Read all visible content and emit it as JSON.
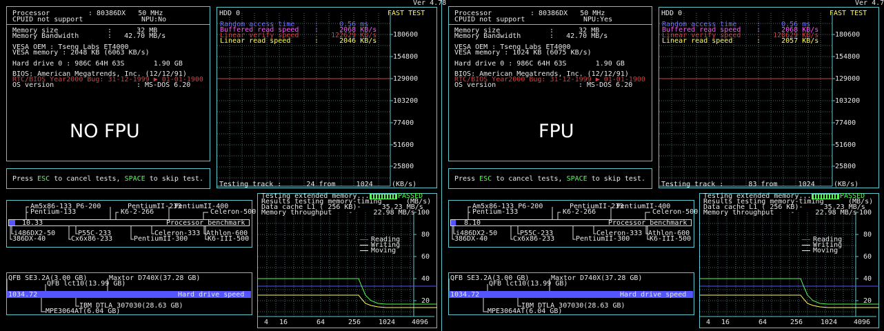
{
  "version": "Ver 4.78",
  "panels": [
    {
      "processor_label": "Processor",
      "processor_value": ": 80386DX   50 MHz",
      "cpuid": "CPUID not support",
      "npu": "NPU:No",
      "mem_size_label": "Memory size",
      "mem_size_value": ":      32 MB",
      "mem_bw_label": "Memory Bandwidth",
      "mem_bw_value": ":   42.70 MB/s",
      "vesa_oem": "VESA OEM : Tseng Labs ET4000",
      "vesa_mem": "VESA memory : 2048 KB (6063 KB/s)",
      "hdd": "Hard drive 0 : 986C 64H 63S       1.90 GB",
      "bios": "BIOS: American Megatrends, Inc. (12/12/91)",
      "y2k": "RTC/BIOS Year2000 Bug: 31-12-1999 ▶ 01-01-1900",
      "os_label": "OS version",
      "os_value": ": MS-DOS 6.20",
      "overlay": "NO FPU",
      "hint_pre": "Press ",
      "hint_esc": "ESC",
      "hint_mid": " to cancel tests, ",
      "hint_space": "SPACE",
      "hint_post": " to skip test.",
      "hdd_title": "HDD 0",
      "fast_test": "FAST TEST",
      "random_label": "Random access time",
      "random_value": ":     0.56 ms",
      "buffered_label": "Buffered read speed",
      "buffered_value": ":     2068 KB/s",
      "verify_label": "Linear verify speed",
      "verify_value": ":   122629 KB/s",
      "linear_label": "Linear read speed",
      "linear_value": ":     2046 KB/s",
      "scale": [
        "180600",
        "154800",
        "129000",
        "103200",
        "77400",
        "51600",
        "25800"
      ],
      "testing_track": "Testing track :      24 from     1024",
      "kbs": "(KB/s)",
      "cpu_top1": "Am5x86-133 P6-200",
      "cpu_top2": "PentiumII-233",
      "cpu_top3": "PentiumII-400",
      "cpu_top4": "Pentium-133",
      "cpu_top5": "K6-2-266",
      "cpu_top6": "Celeron-500",
      "cpu_score": "10.33",
      "cpu_bench_label": "Processor benchmark",
      "cpu_bot1": "i486DX2-50",
      "cpu_bot2": "P55C-233",
      "cpu_bot3": "Celeron-333",
      "cpu_bot4": "Athlon-600",
      "cpu_bot5": "386DX-40",
      "cpu_bot6": "Cx6x86-233",
      "cpu_bot7": "PentiumII-300",
      "cpu_bot8": "K6-III-500",
      "cpu_progress": 0.025,
      "hd_top1": "QFB SE3.2A(3.00 GB)",
      "hd_top2": "Maxtor D740X(37.28 GB)",
      "hd_top3": "QFB lct10(13.99 GB)",
      "hd_score": "1034.72",
      "hd_bench_label": "Hard drive speed",
      "hd_bot1": "IBM DTLA 307030(28.63 GB)",
      "hd_bot2": "MPE3064AT(6.04 GB)",
      "mem_test": "Testing extended memory...",
      "passed": "PASSED",
      "mem_results": "Results testing memory-timing",
      "mbs": "(MB/s)",
      "cache_line": "Data cache L1 ( 256 KB)-     35.23 MB/s",
      "throughput_line": "Memory throughput    -     22.98 MB/s",
      "legend": [
        "Reading",
        "Writing",
        "Moving"
      ],
      "mem_y": [
        "100",
        "80",
        "60",
        "40",
        "20"
      ],
      "mem_x": [
        "4",
        "16",
        "64",
        "256",
        "1024",
        "4096"
      ]
    },
    {
      "processor_label": "Processor",
      "processor_value": ": 80386DX   50 MHz",
      "cpuid": "CPUID not support",
      "npu": "NPU:Yes",
      "mem_size_label": "Memory size",
      "mem_size_value": ":      32 MB",
      "mem_bw_label": "Memory Bandwidth",
      "mem_bw_value": ":   42.70 MB/s",
      "vesa_oem": "VESA OEM : Tseng Labs ET4000",
      "vesa_mem": "VESA memory : 1024 KB (6075 KB/s)",
      "hdd": "Hard drive 0 : 986C 64H 63S       1.90 GB",
      "bios": "BIOS: American Megatrends, Inc. (12/12/91)",
      "y2k": "RTC/BIOS Year2000 Bug: 31-12-1999 ▶ 01-01-1900",
      "os_label": "OS version",
      "os_value": ": MS-DOS 6.20",
      "overlay": "FPU",
      "hint_pre": "Press ",
      "hint_esc": "ESC",
      "hint_mid": " to cancel tests, ",
      "hint_space": "SPACE",
      "hint_post": " to skip test.",
      "hdd_title": "HDD 0",
      "fast_test": "FAST TEST",
      "random_label": "Random access time",
      "random_value": ":     0.56 ms",
      "buffered_label": "Buffered read speed",
      "buffered_value": ":     2068 KB/s",
      "verify_label": "Linear verify speed",
      "verify_value": ":   128629 KB/s",
      "linear_label": "Linear read speed",
      "linear_value": ":     2057 KB/s",
      "scale": [
        "180600",
        "154800",
        "129000",
        "103200",
        "77400",
        "51600",
        "25800"
      ],
      "testing_track": "Testing track :      83 from     1024",
      "kbs": "(KB/s)",
      "cpu_top1": "Am5x86-133 P6-200",
      "cpu_top2": "PentiumII-233",
      "cpu_top3": "PentiumII-400",
      "cpu_top4": "Pentium-133",
      "cpu_top5": "K6-2-266",
      "cpu_top6": "Celeron-500",
      "cpu_score": "8.10",
      "cpu_bench_label": "Processor benchmark",
      "cpu_bot1": "i486DX2-50",
      "cpu_bot2": "P55C-233",
      "cpu_bot3": "Celeron-333",
      "cpu_bot4": "Athlon-600",
      "cpu_bot5": "386DX-40",
      "cpu_bot6": "Cx6x86-233",
      "cpu_bot7": "PentiumII-300",
      "cpu_bot8": "K6-III-500",
      "cpu_progress": 0.02,
      "hd_top1": "QFB SE3.2A(3.00 GB)",
      "hd_top2": "Maxtor D740X(37.28 GB)",
      "hd_top3": "QFB lct10(13.99 GB)",
      "hd_score": "1034.72",
      "hd_bench_label": "Hard drive speed",
      "hd_bot1": "IBM DTLA 307030(28.63 GB)",
      "hd_bot2": "MPE3064AT(6.04 GB)",
      "mem_test": "Testing extended memory...",
      "passed": "PASSED",
      "mem_results": "Results testing memory-timing",
      "mbs": "(MB/s)",
      "cache_line": "Data cache L1 ( 256 KB)-     35.23 MB/s",
      "throughput_line": "Memory throughput    -     22.98 MB/s",
      "legend": [
        "Reading",
        "Writing",
        "Moving"
      ],
      "mem_y": [
        "100",
        "80",
        "60",
        "40",
        "20"
      ],
      "mem_x": [
        "4",
        "16",
        "64",
        "256",
        "1024",
        "4096"
      ]
    }
  ],
  "colors": {
    "frame": "#5fc8cf",
    "reading": "#5555ff",
    "writing": "#ffffff",
    "moving": "#ffff55",
    "hdd_line": "#d04040"
  }
}
